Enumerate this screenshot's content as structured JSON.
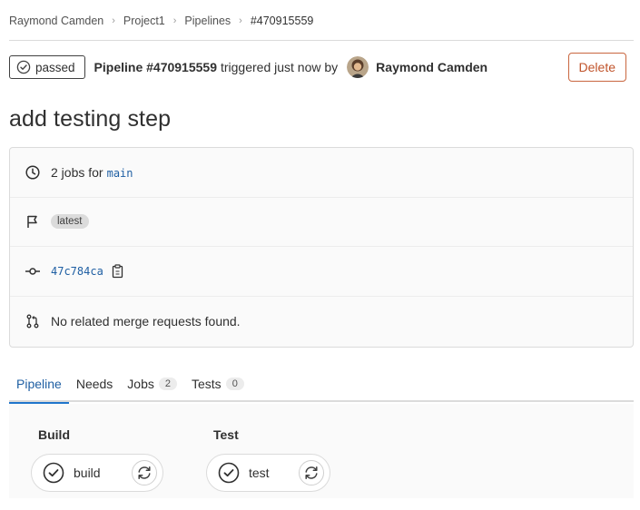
{
  "breadcrumb": {
    "items": [
      "Raymond Camden",
      "Project1",
      "Pipelines",
      "#470915559"
    ],
    "separator": "›"
  },
  "header": {
    "status": "passed",
    "pipeline_label": "Pipeline #470915559",
    "triggered_text": "triggered just now by",
    "author": "Raymond Camden",
    "delete_label": "Delete"
  },
  "title": "add testing step",
  "info": {
    "jobs_prefix": "2 jobs for",
    "branch": "main",
    "tag": "latest",
    "commit_sha": "47c784ca",
    "merge_requests": "No related merge requests found."
  },
  "tabs": [
    {
      "label": "Pipeline",
      "active": true
    },
    {
      "label": "Needs"
    },
    {
      "label": "Jobs",
      "count": "2"
    },
    {
      "label": "Tests",
      "count": "0"
    }
  ],
  "stages": [
    {
      "title": "Build",
      "job": "build",
      "status": "success"
    },
    {
      "title": "Test",
      "job": "test",
      "status": "success"
    }
  ],
  "colors": {
    "accent": "#1f75cb",
    "danger": "#c0532a",
    "link": "#1f5fa3"
  },
  "icons": {
    "status": "check-circle-icon",
    "jobs": "clock-icon",
    "tag": "flag-icon",
    "commit": "commit-icon",
    "copy": "clipboard-icon",
    "merge": "merge-request-icon",
    "retry": "retry-icon"
  }
}
